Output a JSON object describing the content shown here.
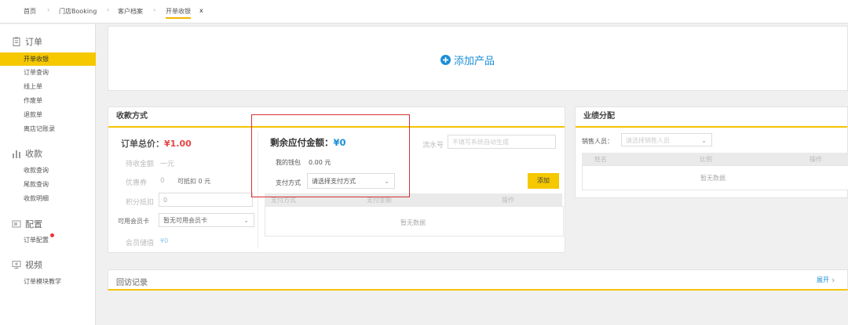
{
  "breadcrumbs": [
    "首页",
    "门店Booking",
    "客户档案",
    "开单收银"
  ],
  "active_tab_close": "x",
  "sidebar": {
    "sections": [
      {
        "title": "订单",
        "items": [
          "开单收银",
          "订单查询",
          "线上单",
          "作废单",
          "退款单",
          "离店记账录"
        ]
      },
      {
        "title": "收款",
        "items": [
          "收款查询",
          "尾款查询",
          "收款明细"
        ]
      },
      {
        "title": "配置",
        "items": [
          "订单配置"
        ]
      },
      {
        "title": "视频",
        "items": [
          "订单模块教学"
        ]
      }
    ]
  },
  "add_product": {
    "label": "添加产品"
  },
  "payment": {
    "panel_title": "收款方式",
    "order_total_label": "订单总价：",
    "order_total_value": "¥1.00",
    "row2_label": "待收金额",
    "row2_value": "一元",
    "row3_label": "优惠券",
    "row3_value": "0",
    "row3_note": "可抵扣 0 元",
    "row4_label": "积分抵扣",
    "row4_value": "0",
    "member_card_label": "可用会员卡",
    "member_card_value": "暂无可用会员卡",
    "row6_label": "会员储值",
    "row6_value": "¥0",
    "remaining_label": "剩余应付金额：",
    "remaining_value": "¥0",
    "wallet_label": "我的钱包",
    "wallet_value": "0.00 元",
    "pay_method_label": "支付方式",
    "pay_method_value": "请选择支付方式",
    "serial_label": "流水号",
    "serial_placeholder": "不填写系统自动生成",
    "add_button": "添加",
    "table_cols": [
      "支付方式",
      "支付金额",
      "操作"
    ],
    "table_empty": "暂无数据"
  },
  "performance": {
    "panel_title": "业绩分配",
    "sales_label": "销售人员：",
    "sales_placeholder": "请选择销售人员",
    "table_cols": [
      "姓名",
      "比例",
      "操作"
    ],
    "table_empty": "暂无数据"
  },
  "history": {
    "title": "回访记录",
    "expand": "展开"
  },
  "colors": {
    "accent": "#f5c800",
    "blue": "#1a8fd8",
    "red": "#e64545",
    "highlight": "#d63030"
  }
}
